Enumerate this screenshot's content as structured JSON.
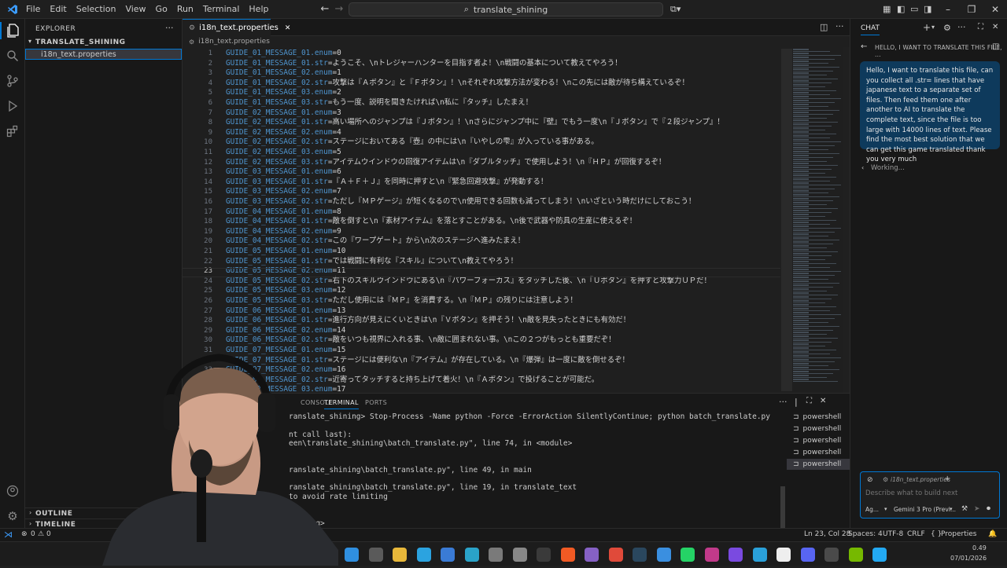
{
  "titlebar": {
    "menu": [
      "File",
      "Edit",
      "Selection",
      "View",
      "Go",
      "Run",
      "Terminal",
      "Help"
    ],
    "search": "translate_shining"
  },
  "sidebar": {
    "title": "EXPLORER",
    "folder": "TRANSLATE_SHINING",
    "file": "i18n_text.properties",
    "outline": "OUTLINE",
    "timeline": "TIMELINE"
  },
  "editor": {
    "tab_label": "i18n_text.properties",
    "breadcrumb": "i18n_text.properties",
    "current_line": 23,
    "lines": [
      {
        "n": "1",
        "key": "GUIDE_01_MESSAGE_01.enum",
        "val": "=0"
      },
      {
        "n": "2",
        "key": "GUIDE_01_MESSAGE_01.str",
        "val": "=ようこそ、\\nトレジャーハンターを目指す者よ！\\n戦闘の基本について教えてやろう！"
      },
      {
        "n": "3",
        "key": "GUIDE_01_MESSAGE_02.enum",
        "val": "=1"
      },
      {
        "n": "4",
        "key": "GUIDE_01_MESSAGE_02.str",
        "val": "=攻撃は『Ａボタン』と『Ｆボタン』！\\nそれぞれ攻撃方法が変わる！\\nこの先には敵が待ち構えているぞ！"
      },
      {
        "n": "5",
        "key": "GUIDE_01_MESSAGE_03.enum",
        "val": "=2"
      },
      {
        "n": "6",
        "key": "GUIDE_01_MESSAGE_03.str",
        "val": "=もう一度、説明を聞きたければ\\n私に『タッチ』したまえ！"
      },
      {
        "n": "7",
        "key": "GUIDE_02_MESSAGE_01.enum",
        "val": "=3"
      },
      {
        "n": "8",
        "key": "GUIDE_02_MESSAGE_01.str",
        "val": "=高い場所へのジャンプは『Ｊボタン』！\\nさらにジャンプ中に『壁』でもう一度\\n『Ｊボタン』で『２段ジャンプ』！"
      },
      {
        "n": "9",
        "key": "GUIDE_02_MESSAGE_02.enum",
        "val": "=4"
      },
      {
        "n": "10",
        "key": "GUIDE_02_MESSAGE_02.str",
        "val": "=ステージにおいてある『壺』の中には\\n『いやしの雫』が入っている事がある。"
      },
      {
        "n": "11",
        "key": "GUIDE_02_MESSAGE_03.enum",
        "val": "=5"
      },
      {
        "n": "12",
        "key": "GUIDE_02_MESSAGE_03.str",
        "val": "=アイテムウインドウの回復アイテムは\\n『ダブルタッチ』で使用しよう！\\n『ＨＰ』が回復するぞ！"
      },
      {
        "n": "13",
        "key": "GUIDE_03_MESSAGE_01.enum",
        "val": "=6"
      },
      {
        "n": "14",
        "key": "GUIDE_03_MESSAGE_01.str",
        "val": "=『Ａ＋Ｆ＋Ｊ』を同時に押すと\\n『緊急回避攻撃』が発動する！"
      },
      {
        "n": "15",
        "key": "GUIDE_03_MESSAGE_02.enum",
        "val": "=7"
      },
      {
        "n": "16",
        "key": "GUIDE_03_MESSAGE_02.str",
        "val": "=ただし『ＭＰゲージ』が短くなるので\\n使用できる回数も減ってしまう！\\nいざという時だけにしておこう！"
      },
      {
        "n": "17",
        "key": "GUIDE_04_MESSAGE_01.enum",
        "val": "=8"
      },
      {
        "n": "18",
        "key": "GUIDE_04_MESSAGE_01.str",
        "val": "=敵を倒すと\\n『素材アイテム』を落とすことがある。\\n後で武器や防具の生産に使えるぞ！"
      },
      {
        "n": "19",
        "key": "GUIDE_04_MESSAGE_02.enum",
        "val": "=9"
      },
      {
        "n": "20",
        "key": "GUIDE_04_MESSAGE_02.str",
        "val": "=この『ワープゲート』から\\n次のステージへ進みたまえ！"
      },
      {
        "n": "21",
        "key": "GUIDE_05_MESSAGE_01.enum",
        "val": "=10"
      },
      {
        "n": "22",
        "key": "GUIDE_05_MESSAGE_01.str",
        "val": "=では戦闘に有利な『スキル』について\\n教えてやろう！"
      },
      {
        "n": "23",
        "key": "GUIDE_05_MESSAGE_02.enum",
        "val": "=11"
      },
      {
        "n": "24",
        "key": "GUIDE_05_MESSAGE_02.str",
        "val": "=右下のスキルウインドウにある\\n『パワーフォーカス』をタッチした後、\\n『Ｕボタン』を押すと攻撃力ＵＰだ！"
      },
      {
        "n": "25",
        "key": "GUIDE_05_MESSAGE_03.enum",
        "val": "=12"
      },
      {
        "n": "26",
        "key": "GUIDE_05_MESSAGE_03.str",
        "val": "=ただし使用には『ＭＰ』を消費する。\\n『ＭＰ』の残りには注意しよう！"
      },
      {
        "n": "27",
        "key": "GUIDE_06_MESSAGE_01.enum",
        "val": "=13"
      },
      {
        "n": "28",
        "key": "GUIDE_06_MESSAGE_01.str",
        "val": "=進行方向が見えにくいときは\\n『Ｖボタン』を押そう！\\n敵を見失ったときにも有効だ！"
      },
      {
        "n": "29",
        "key": "GUIDE_06_MESSAGE_02.enum",
        "val": "=14"
      },
      {
        "n": "30",
        "key": "GUIDE_06_MESSAGE_02.str",
        "val": "=敵をいつも視界に入れる事、\\n敵に囲まれない事。\\nこの２つがもっとも重要だぞ！"
      },
      {
        "n": "31",
        "key": "GUIDE_07_MESSAGE_01.enum",
        "val": "=15"
      },
      {
        "n": "32",
        "key": "GUIDE_07_MESSAGE_01.str",
        "val": "=ステージには便利な\\n『アイテム』が存在している。\\n『爆弾』は一度に敵を倒せるぞ！"
      },
      {
        "n": "33",
        "key": "GUIDE_07_MESSAGE_02.enum",
        "val": "=16"
      },
      {
        "n": "34",
        "key": "GUIDE_07_MESSAGE_02.str",
        "val": "=近寄ってタッチすると持ち上げて着火！\\n『Ａボタン』で投げることが可能だ。"
      },
      {
        "n": "35",
        "key": "GUIDE_07_MESSAGE_03.enum",
        "val": "=17"
      }
    ]
  },
  "panel": {
    "tabs": [
      "CONSOLE",
      "TERMINAL",
      "PORTS"
    ],
    "terminal_lines": [
      "ranslate_shining> Stop-Process -Name python -Force -ErrorAction SilentlyContinue; python batch_translate.py",
      "",
      "nt call last):",
      "een\\translate_shining\\batch_translate.py\", line 74, in <module>",
      "",
      "",
      "ranslate_shining\\batch_translate.py\", line 49, in main",
      "",
      "ranslate_shining\\batch_translate.py\", line 19, in translate_text",
      "  to avoid rate limiting",
      "",
      "",
      "shining> "
    ],
    "shells": [
      "powershell",
      "powershell",
      "powershell",
      "powershell",
      "powershell"
    ]
  },
  "chat": {
    "header": "CHAT",
    "conversation_title": "HELLO, I WANT TO TRANSLATE THIS FILE, ...",
    "message": "Hello, I want to translate this file, can you collect all .str= lines that have japanese text to a separate set of files. Then feed them one after another to AI to translate the complete text, since the file is too large with 14000 lines of text. Please find the most best solution that we can get this game translated thank you very much",
    "status": "Working...",
    "context_file": "i18n_text.properties",
    "input_placeholder": "Describe what to build next",
    "agent_label": "Ag...",
    "model_label": "Gemini 3 Pro (Previ..."
  },
  "statusbar": {
    "errors": "0",
    "warnings": "0",
    "position": "Ln 23, Col 28",
    "spaces": "Spaces: 4",
    "encoding": "UTF-8",
    "eol": "CRLF",
    "language": "Properties"
  },
  "taskbar": {
    "time": "0.49",
    "date": "07/01/2026"
  },
  "colors": {
    "accent": "#0078d4",
    "key": "#4e94ce",
    "chat_bubble": "#0e3a5c"
  }
}
